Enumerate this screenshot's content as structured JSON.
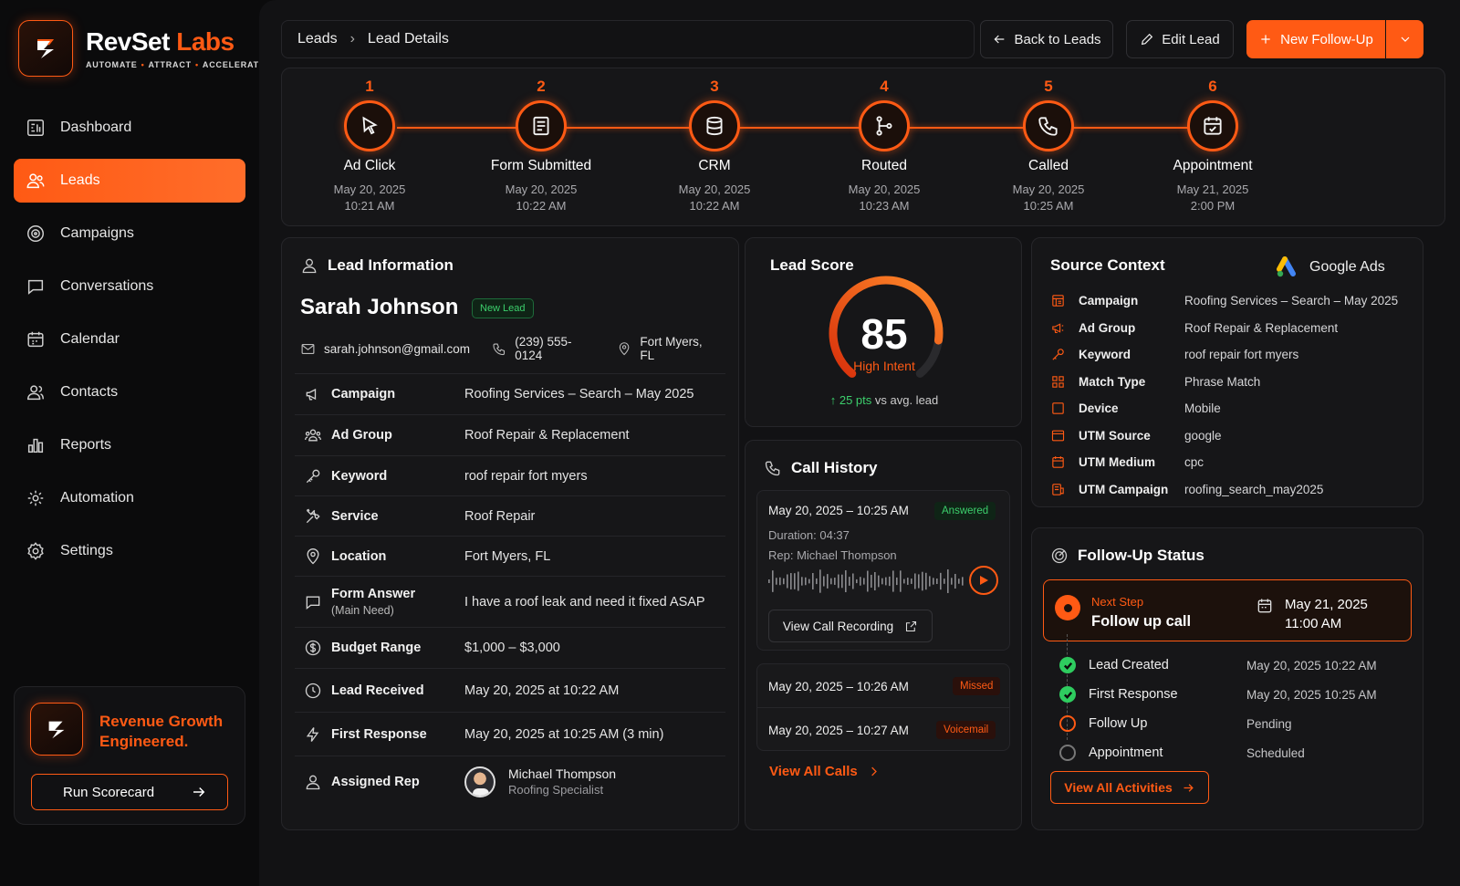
{
  "brand": {
    "name_main": "RevSet",
    "name_accent": "Labs",
    "tagline": [
      "AUTOMATE",
      "ATTRACT",
      "ACCELERATE"
    ],
    "accent_color": "#ff5a14"
  },
  "sidebar": {
    "items": [
      {
        "label": "Dashboard",
        "icon": "dashboard-icon"
      },
      {
        "label": "Leads",
        "icon": "users-icon",
        "active": true
      },
      {
        "label": "Campaigns",
        "icon": "target-icon"
      },
      {
        "label": "Conversations",
        "icon": "chat-icon"
      },
      {
        "label": "Calendar",
        "icon": "calendar-icon"
      },
      {
        "label": "Contacts",
        "icon": "contacts-icon"
      },
      {
        "label": "Reports",
        "icon": "bar-chart-icon"
      },
      {
        "label": "Automation",
        "icon": "automation-icon"
      },
      {
        "label": "Settings",
        "icon": "gear-icon"
      }
    ],
    "promo": {
      "text_line1": "Revenue Growth",
      "text_line2": "Engineered.",
      "button": "Run Scorecard"
    }
  },
  "header": {
    "breadcrumb": [
      "Leads",
      "Lead Details"
    ],
    "back_btn": "Back to Leads",
    "edit_btn": "Edit Lead",
    "new_btn": "New Follow-Up"
  },
  "timeline": [
    {
      "num": "1",
      "title": "Ad Click",
      "date": "May 20, 2025",
      "time": "10:21 AM",
      "icon": "cursor-icon"
    },
    {
      "num": "2",
      "title": "Form Submitted",
      "date": "May 20, 2025",
      "time": "10:22 AM",
      "icon": "form-icon"
    },
    {
      "num": "3",
      "title": "CRM",
      "date": "May 20, 2025",
      "time": "10:22 AM",
      "icon": "database-icon"
    },
    {
      "num": "4",
      "title": "Routed",
      "date": "May 20, 2025",
      "time": "10:23 AM",
      "icon": "route-icon"
    },
    {
      "num": "5",
      "title": "Called",
      "date": "May 20, 2025",
      "time": "10:25 AM",
      "icon": "phone-icon"
    },
    {
      "num": "6",
      "title": "Appointment",
      "date": "May 21, 2025",
      "time": "2:00 PM",
      "icon": "calendar-check-icon"
    }
  ],
  "lead": {
    "section_title": "Lead Information",
    "name": "Sarah Johnson",
    "badge": "New Lead",
    "email": "sarah.johnson@gmail.com",
    "phone": "(239) 555-0124",
    "location": "Fort Myers, FL",
    "rows": [
      {
        "label": "Campaign",
        "value": "Roofing Services – Search – May 2025",
        "icon": "megaphone-icon"
      },
      {
        "label": "Ad Group",
        "value": "Roof Repair & Replacement",
        "icon": "group-icon"
      },
      {
        "label": "Keyword",
        "value": "roof repair fort myers",
        "icon": "key-icon"
      },
      {
        "label": "Service",
        "value": "Roof Repair",
        "icon": "tools-icon"
      },
      {
        "label": "Location",
        "value": "Fort Myers, FL",
        "icon": "pin-icon"
      },
      {
        "label": "Form Answer",
        "sub": "(Main Need)",
        "value": "I have a roof leak and need it fixed ASAP",
        "icon": "message-icon"
      },
      {
        "label": "Budget Range",
        "value": "$1,000 – $3,000",
        "icon": "dollar-icon"
      },
      {
        "label": "Lead Received",
        "value": "May 20, 2025 at 10:22 AM",
        "icon": "clock-icon"
      },
      {
        "label": "First Response",
        "value": "May 20, 2025 at 10:25 AM (3 min)",
        "icon": "bolt-icon"
      }
    ],
    "assigned": {
      "label": "Assigned Rep",
      "name": "Michael Thompson",
      "role": "Roofing Specialist"
    }
  },
  "score": {
    "title": "Lead Score",
    "value": "85",
    "level": 85,
    "label": "High Intent",
    "delta": "25 pts",
    "delta_suffix": "vs avg. lead"
  },
  "calls": {
    "title": "Call History",
    "first": {
      "date": "May 20, 2025 – 10:25 AM",
      "status": "Answered",
      "duration": "Duration:  04:37",
      "rep": "Rep:  Michael Thompson",
      "recording_btn": "View Call Recording"
    },
    "others": [
      {
        "date": "May 20, 2025 – 10:26 AM",
        "status": "Missed"
      },
      {
        "date": "May 20, 2025 – 10:27 AM",
        "status": "Voicemail"
      }
    ],
    "view_all": "View All Calls"
  },
  "source": {
    "title": "Source Context",
    "platform": "Google Ads",
    "rows": [
      {
        "label": "Campaign",
        "value": "Roofing Services – Search – May 2025"
      },
      {
        "label": "Ad Group",
        "value": "Roof Repair & Replacement"
      },
      {
        "label": "Keyword",
        "value": "roof repair fort myers"
      },
      {
        "label": "Match Type",
        "value": "Phrase Match"
      },
      {
        "label": "Device",
        "value": "Mobile"
      },
      {
        "label": "UTM Source",
        "value": "google"
      },
      {
        "label": "UTM Medium",
        "value": "cpc"
      },
      {
        "label": "UTM Campaign",
        "value": "roofing_search_may2025"
      }
    ]
  },
  "follow": {
    "title": "Follow-Up Status",
    "next_label": "Next Step",
    "next_title": "Follow up call",
    "next_date": "May 21, 2025",
    "next_time": "11:00 AM",
    "activities": [
      {
        "label": "Lead Created",
        "date": "May 20, 2025  10:22 AM",
        "state": "done"
      },
      {
        "label": "First Response",
        "date": "May 20, 2025  10:25 AM",
        "state": "done"
      },
      {
        "label": "Follow Up",
        "date": "Pending",
        "state": "pending"
      },
      {
        "label": "Appointment",
        "date": "Scheduled",
        "state": "scheduled"
      }
    ],
    "view_all": "View All Activities"
  }
}
